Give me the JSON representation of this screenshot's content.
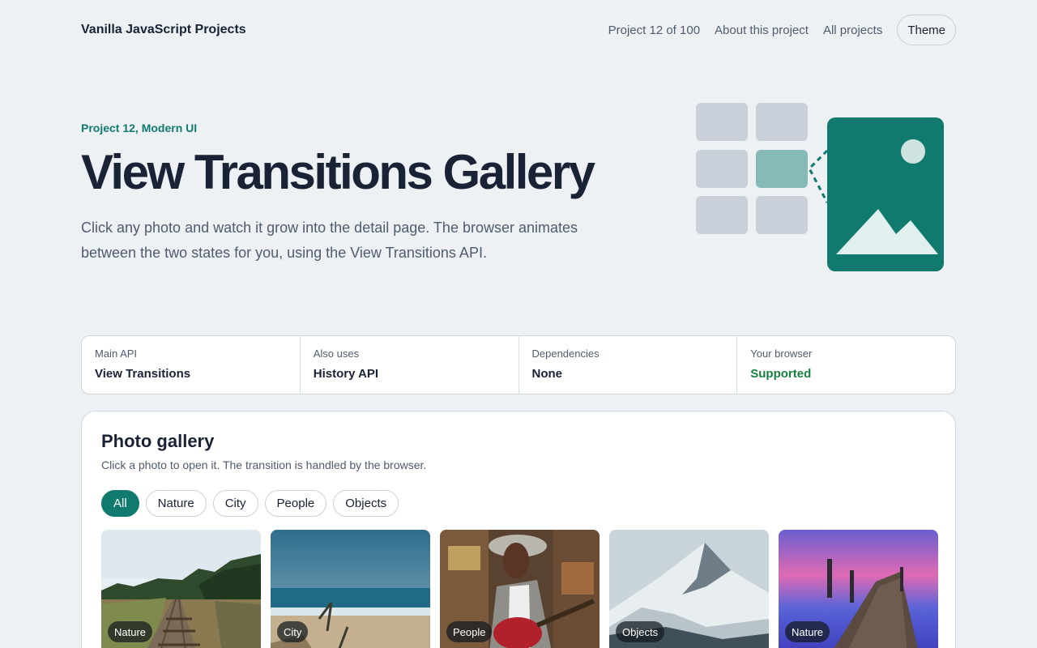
{
  "header": {
    "brand": "Vanilla JavaScript Projects",
    "nav": {
      "progress": "Project 12 of 100",
      "about": "About this project",
      "all": "All projects",
      "theme": "Theme"
    }
  },
  "hero": {
    "kicker": "Project 12, Modern UI",
    "title": "View Transitions Gallery",
    "lead": "Click any photo and watch it grow into the detail page. The browser animates between the two states for you, using the View Transitions API.",
    "illustration_icon": "grid-to-image-icon"
  },
  "stats": [
    {
      "label": "Main API",
      "value": "View Transitions"
    },
    {
      "label": "Also uses",
      "value": "History API"
    },
    {
      "label": "Dependencies",
      "value": "None"
    },
    {
      "label": "Your browser",
      "value": "Supported"
    }
  ],
  "gallery": {
    "title": "Photo gallery",
    "subtitle": "Click a photo to open it. The transition is handled by the browser.",
    "filters": [
      "All",
      "Nature",
      "City",
      "People",
      "Objects"
    ],
    "active_filter": "All",
    "photos": [
      {
        "tag": "Nature",
        "scene": "railway-tracks"
      },
      {
        "tag": "City",
        "scene": "beach-ocean"
      },
      {
        "tag": "People",
        "scene": "woman-guitar"
      },
      {
        "tag": "Objects",
        "scene": "snowy-mountain"
      },
      {
        "tag": "Nature",
        "scene": "lake-pier-sunset"
      }
    ]
  },
  "colors": {
    "accent": "#117a6e",
    "supported": "#18803f",
    "background": "#edf1f4"
  }
}
